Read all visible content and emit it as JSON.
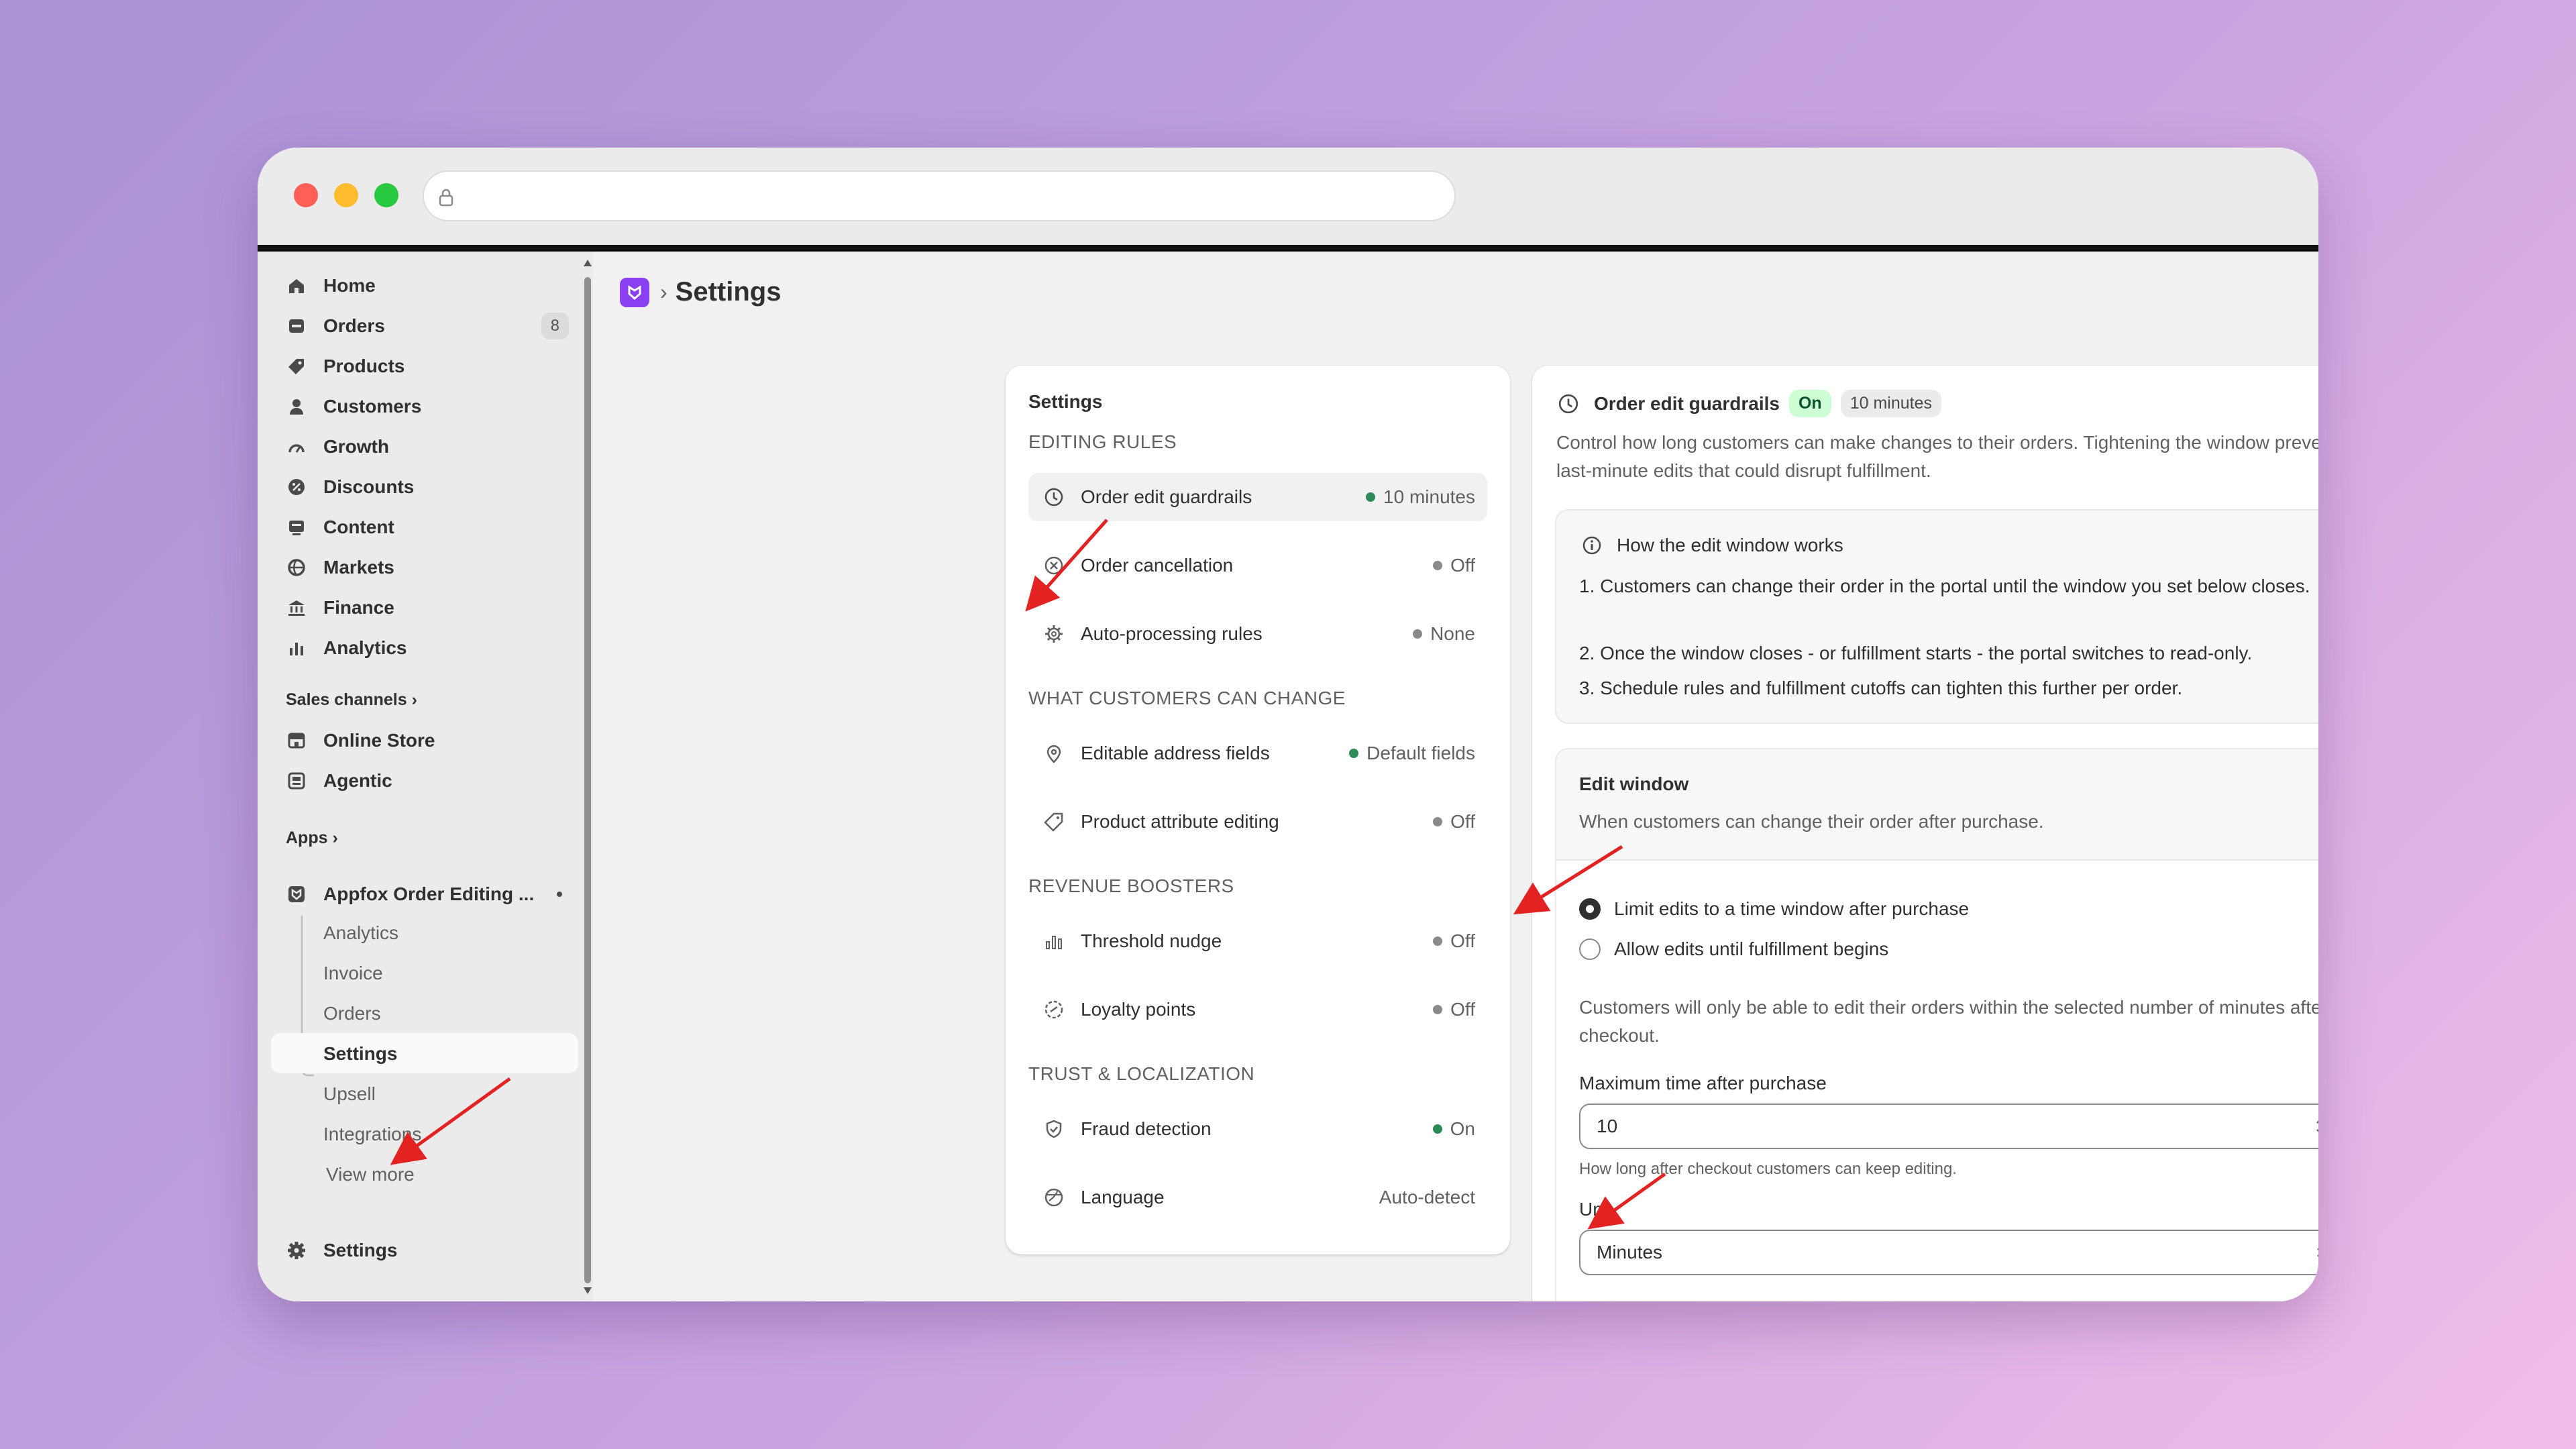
{
  "sidebar": {
    "items": [
      {
        "label": "Home",
        "icon": "home-icon"
      },
      {
        "label": "Orders",
        "icon": "orders-icon",
        "badge": "8"
      },
      {
        "label": "Products",
        "icon": "tag-icon"
      },
      {
        "label": "Customers",
        "icon": "person-icon"
      },
      {
        "label": "Growth",
        "icon": "gauge-icon"
      },
      {
        "label": "Discounts",
        "icon": "discount-icon"
      },
      {
        "label": "Content",
        "icon": "content-icon"
      },
      {
        "label": "Markets",
        "icon": "globe-icon"
      },
      {
        "label": "Finance",
        "icon": "bank-icon"
      },
      {
        "label": "Analytics",
        "icon": "bar-chart-icon"
      }
    ],
    "sales_channels_label": "Sales channels",
    "channels": [
      {
        "label": "Online Store",
        "icon": "store-icon"
      },
      {
        "label": "Agentic",
        "icon": "agentic-icon"
      }
    ],
    "apps_label": "Apps",
    "app": {
      "name": "Appfox Order Editing ...",
      "subitems": [
        "Analytics",
        "Invoice",
        "Orders",
        "Settings",
        "Upsell",
        "Integrations"
      ],
      "view_more": "View more"
    },
    "settings_label": "Settings"
  },
  "header": {
    "separator": "›",
    "title": "Settings",
    "more": "···"
  },
  "settings_card": {
    "title": "Settings",
    "sections": [
      {
        "title": "EDITING RULES",
        "rows": [
          {
            "label": "Order edit guardrails",
            "status": "10 minutes",
            "dot": "#2e8b57",
            "icon": "clock-icon"
          },
          {
            "label": "Order cancellation",
            "status": "Off",
            "dot": "#8a8a8a",
            "icon": "x-circle-icon"
          },
          {
            "label": "Auto-processing rules",
            "status": "None",
            "dot": "#8a8a8a",
            "icon": "gear-icon"
          }
        ]
      },
      {
        "title": "WHAT CUSTOMERS CAN CHANGE",
        "rows": [
          {
            "label": "Editable address fields",
            "status": "Default fields",
            "dot": "#2e8b57",
            "icon": "location-pin-icon"
          },
          {
            "label": "Product attribute editing",
            "status": "Off",
            "dot": "#8a8a8a",
            "icon": "tag-icon"
          }
        ]
      },
      {
        "title": "REVENUE BOOSTERS",
        "rows": [
          {
            "label": "Threshold nudge",
            "status": "Off",
            "dot": "#8a8a8a",
            "icon": "bar-chart-icon"
          },
          {
            "label": "Loyalty points",
            "status": "Off",
            "dot": "#8a8a8a",
            "icon": "points-icon"
          }
        ]
      },
      {
        "title": "TRUST & LOCALIZATION",
        "rows": [
          {
            "label": "Fraud detection",
            "status": "On",
            "dot": "#2e8b57",
            "icon": "shield-icon"
          },
          {
            "label": "Language",
            "status": "Auto-detect",
            "dot": "",
            "icon": "language-icon"
          }
        ]
      }
    ]
  },
  "detail": {
    "title": "Order edit guardrails",
    "status_pill": "On",
    "time_pill": "10 minutes",
    "description": "Control how long customers can make changes to their orders. Tightening the window prevents last-minute edits that could disrupt fulfillment.",
    "how": {
      "title": "How the edit window works",
      "steps": [
        "Customers can change their order in the portal until the window you set below closes.",
        "Once the window closes - or fulfillment starts - the portal switches to read-only.",
        "Schedule rules and fulfillment cutoffs can tighten this further per order."
      ]
    },
    "edit_window": {
      "title": "Edit window",
      "subtitle": "When customers can change their order after purchase.",
      "option_limit": "Limit edits to a time window after purchase",
      "option_fulfillment": "Allow edits until fulfillment begins",
      "note": "Customers will only be able to edit their orders within the selected number of minutes after checkout.",
      "max_label": "Maximum time after purchase",
      "max_value": "10",
      "max_help": "How long after checkout customers can keep editing.",
      "unit_label": "Unit",
      "unit_value": "Minutes"
    }
  },
  "colors": {
    "accent_purple": "#8a3ff0",
    "status_green": "#2e8b57",
    "pill_green_bg": "#cdfed4",
    "chat_blue": "#1f6fe0",
    "annotation_red": "#e32222"
  }
}
